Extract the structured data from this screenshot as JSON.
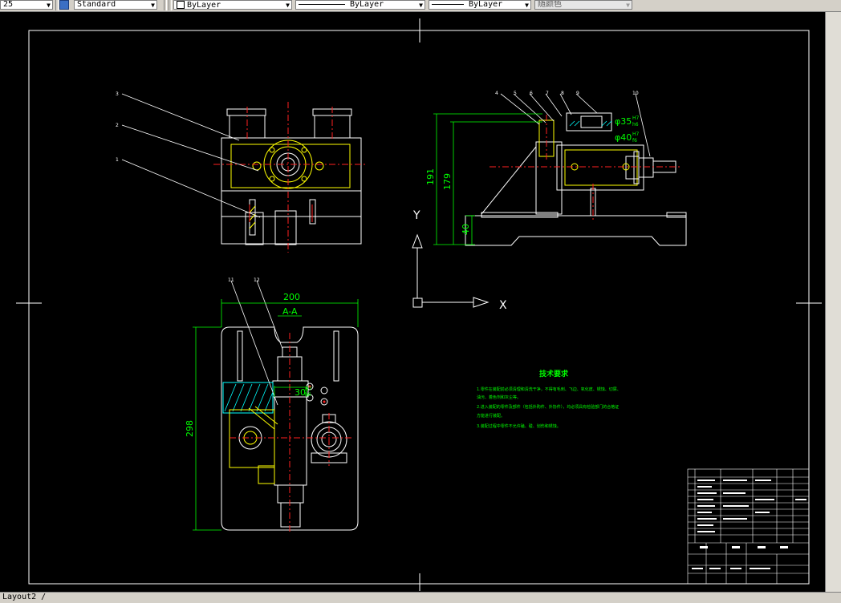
{
  "toolbar": {
    "fields": [
      {
        "id": "field-dimstyle",
        "value": "25"
      },
      {
        "id": "field-textstyle",
        "value": "Standard"
      },
      {
        "id": "field-layer",
        "value": "ByLayer"
      },
      {
        "id": "field-linetype",
        "value": "ByLayer"
      },
      {
        "id": "field-lineweight",
        "value": "ByLayer"
      },
      {
        "id": "field-plotstyle",
        "value": "随颜色"
      }
    ]
  },
  "drawing": {
    "labels": {
      "l1": "1",
      "l2": "2",
      "l3": "3",
      "l4": "4",
      "l5": "5",
      "l6": "6",
      "l7": "7",
      "l8": "8",
      "l9": "9",
      "l10": "10",
      "l11": "11",
      "l12": "12"
    },
    "dims": {
      "d191": "191",
      "d179": "179",
      "d40": "40",
      "dia35": "φ35",
      "dia35_tol": "H7",
      "dia35_tol2": "h6",
      "dia40": "φ40",
      "dia40_tol": "H7",
      "dia40_tol2": "f6",
      "d200": "200",
      "section": "A-A",
      "d298": "298",
      "d30": "30",
      "d30_tol": "H7",
      "d30_tol2": "h6"
    },
    "axes": {
      "x": "X",
      "y": "Y"
    },
    "notes": {
      "title": "技术要求",
      "line1": "1.零件在装配前必须清理和清洗干净，不得有毛刺、飞边、氧化皮、锈蚀、切屑、",
      "line2": "油污、着色剂和灰尘等。",
      "line3": "2.进入装配的零件及部件（包括外购件、外协件），均必须具有检验部门的合格证",
      "line4": "方能进行装配。",
      "line5": "3.装配过程中零件不允许磕、碰、划伤和锈蚀。"
    }
  },
  "statusbar": {
    "tab": "Layout2"
  },
  "colors": {
    "canvas": "#000000",
    "frame": "#ffffff",
    "dimension": "#00ff00",
    "centerline": "#ff2020",
    "part_outline": "#ffffff",
    "hidden": "#ffff00",
    "hatch": "#00ffff"
  }
}
